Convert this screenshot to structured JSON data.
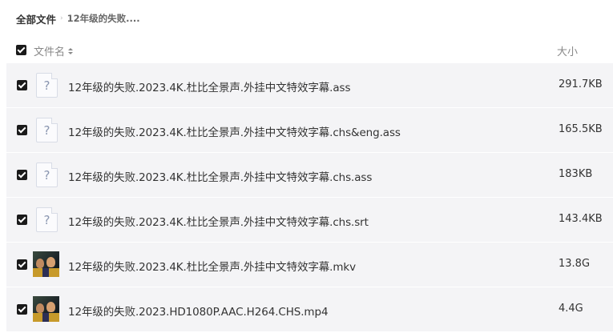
{
  "breadcrumb": {
    "root": "全部文件",
    "separator": "›",
    "current": "12年级的失败...."
  },
  "header": {
    "name_label": "文件名",
    "size_label": "大小"
  },
  "files": [
    {
      "name": "12年级的失败.2023.4K.杜比全景声.外挂中文特效字幕.ass",
      "size": "291.7KB",
      "icon": "unknown-file-icon"
    },
    {
      "name": "12年级的失败.2023.4K.杜比全景声.外挂中文特效字幕.chs&eng.ass",
      "size": "165.5KB",
      "icon": "unknown-file-icon"
    },
    {
      "name": "12年级的失败.2023.4K.杜比全景声.外挂中文特效字幕.chs.ass",
      "size": "183KB",
      "icon": "unknown-file-icon"
    },
    {
      "name": "12年级的失败.2023.4K.杜比全景声.外挂中文特效字幕.chs.srt",
      "size": "143.4KB",
      "icon": "unknown-file-icon"
    },
    {
      "name": "12年级的失败.2023.4K.杜比全景声.外挂中文特效字幕.mkv",
      "size": "13.8G",
      "icon": "video-thumbnail"
    },
    {
      "name": "12年级的失败.2023.HD1080P.AAC.H264.CHS.mp4",
      "size": "4.4G",
      "icon": "video-thumbnail"
    }
  ]
}
